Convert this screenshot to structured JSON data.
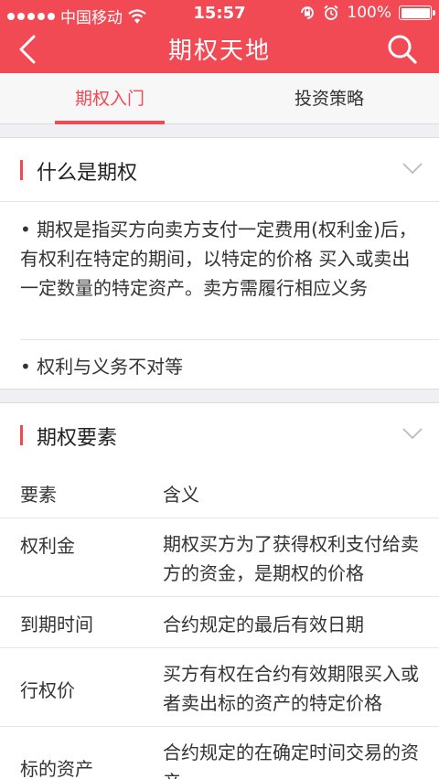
{
  "status_bar": {
    "carrier": "中国移动",
    "time": "15:57",
    "battery": "100%"
  },
  "nav": {
    "title": "期权天地"
  },
  "tabs": [
    {
      "label": "期权入门",
      "active": true
    },
    {
      "label": "投资策略",
      "active": false
    }
  ],
  "section1": {
    "title": "什么是期权",
    "paragraphs": [
      "• 期权是指买方向卖方支付一定费用(权利金)后，有权利在特定的期间，以特定的价格 买入或卖出一定数量的特定资产。卖方需履行相应义务",
      "• 权利与义务不对等"
    ]
  },
  "section2": {
    "title": "期权要素",
    "header": {
      "key": "要素",
      "value": "含义"
    },
    "rows": [
      {
        "key": "权利金",
        "value": "期权买方为了获得权利支付给卖方的资金，是期权的价格"
      },
      {
        "key": "到期时间",
        "value": "合约规定的最后有效日期"
      },
      {
        "key": "行权价",
        "value": "买方有权在合约有效期限买入或者卖出标的资产的特定价格"
      },
      {
        "key": "标的资产",
        "value": "合约规定的在确定时间交易的资产"
      }
    ]
  },
  "colors": {
    "accent": "#f24a55",
    "background": "#efeff4"
  }
}
